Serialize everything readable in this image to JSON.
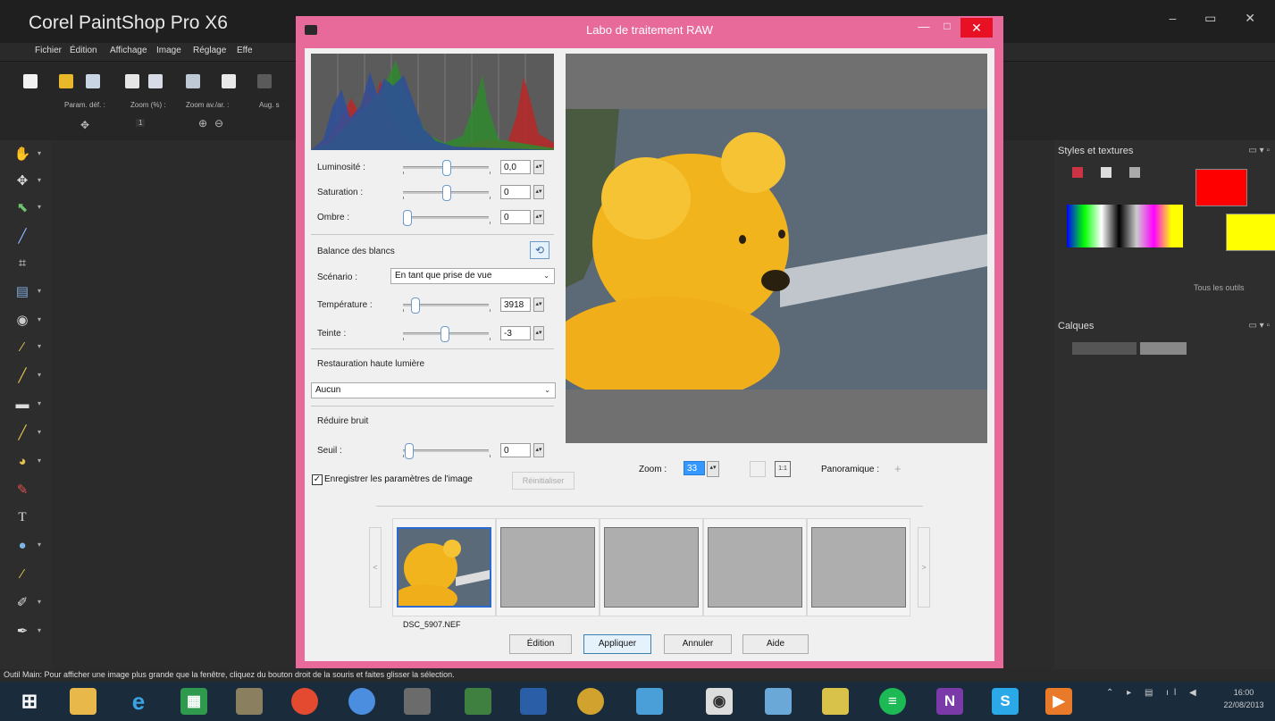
{
  "app": {
    "title": "Corel PaintShop Pro X6",
    "window_controls": "– ▭ ✕"
  },
  "menu": [
    "Fichier",
    "Édition",
    "Affichage",
    "Image",
    "Réglage",
    "Effe"
  ],
  "toolbar": {
    "labels": [
      "Param. déf. :",
      "Zoom (%) :",
      "Zoom av./ar. :",
      "Aug. s"
    ],
    "zoom_value": "1"
  },
  "right_panel": {
    "styles_title": "Styles et textures",
    "all_tools_label": "Tous les outils",
    "layers_title": "Calques",
    "panel_ctrl": "▭ ▾ ▫",
    "colors": {
      "foreground": "#ff0000",
      "background": "#ffff00"
    }
  },
  "status": {
    "text": "Outil Main: Pour afficher une image plus grande que la fenêtre, cliquez du bouton droit de la souris et faites glisser la sélection."
  },
  "taskbar": {
    "tray": "⌃ ▸ ▤ ıl ◀",
    "time": "16:00",
    "date": "22/08/2013"
  },
  "dialog": {
    "title": "Labo de traitement RAW",
    "min": "—",
    "max": "□",
    "close": "✕",
    "sliders": {
      "luminosite": {
        "label": "Luminosité :",
        "value": "0,0"
      },
      "saturation": {
        "label": "Saturation :",
        "value": "0"
      },
      "ombre": {
        "label": "Ombre :",
        "value": "0"
      }
    },
    "white_balance": {
      "title": "Balance des blancs",
      "scenario_label": "Scénario :",
      "scenario_value": "En tant que prise de vue",
      "temperature_label": "Température :",
      "temperature_value": "3918",
      "teinte_label": "Teinte :",
      "teinte_value": "-3"
    },
    "highlight": {
      "title": "Restauration haute lumière",
      "value": "Aucun"
    },
    "noise": {
      "title": "Réduire bruit",
      "seuil_label": "Seuil :",
      "seuil_value": "0"
    },
    "save_settings_label": "Enregistrer les paramètres de l'image",
    "reset_label": "Réinitialiser",
    "zoom_label": "Zoom :",
    "zoom_value": "33",
    "pan_label": "Panoramique :",
    "thumbnail_name": "DSC_5907.NEF",
    "nav_prev": "<",
    "nav_next": ">",
    "buttons": {
      "edit": "Édition",
      "apply": "Appliquer",
      "cancel": "Annuler",
      "help": "Aide"
    }
  }
}
